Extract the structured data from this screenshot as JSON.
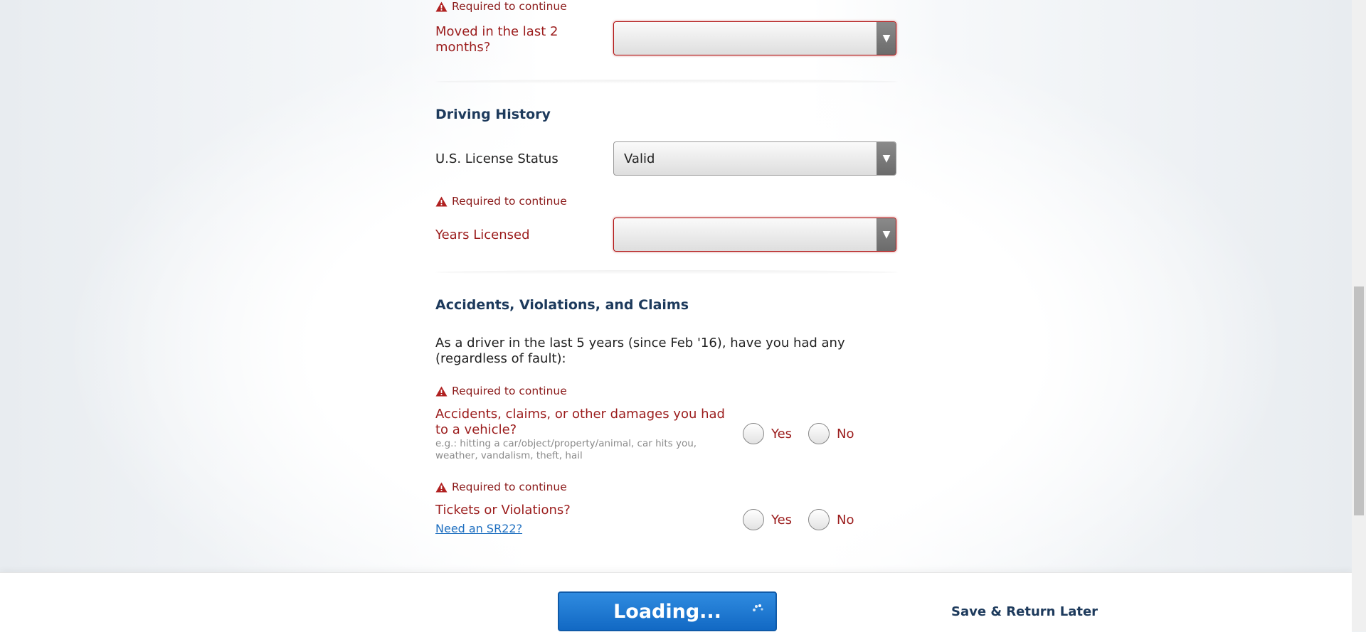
{
  "errors": {
    "required": "Required to continue"
  },
  "moved": {
    "label": "Moved in the last 2 months?",
    "value": ""
  },
  "driving_history": {
    "heading": "Driving History",
    "license_label": "U.S. License Status",
    "license_value": "Valid",
    "years_label": "Years Licensed",
    "years_value": ""
  },
  "avc": {
    "heading": "Accidents, Violations, and Claims",
    "intro": "As a driver in the last 5 years (since Feb '16), have you had any (regardless of fault):",
    "accidents_label": "Accidents, claims, or other damages you had to a vehicle?",
    "accidents_hint": "e.g.: hitting a car/object/property/animal, car hits you, weather, vandalism, theft, hail",
    "tickets_label": "Tickets or Violations?",
    "sr22_link": "Need an SR22?",
    "yes": "Yes",
    "no": "No"
  },
  "footer": {
    "loading_label": "Loading...",
    "save_label": "Save & Return Later"
  },
  "colors": {
    "error": "#9b1c1c",
    "heading": "#1d3a5c",
    "button": "#1a75d2",
    "link": "#1e6fc0"
  }
}
